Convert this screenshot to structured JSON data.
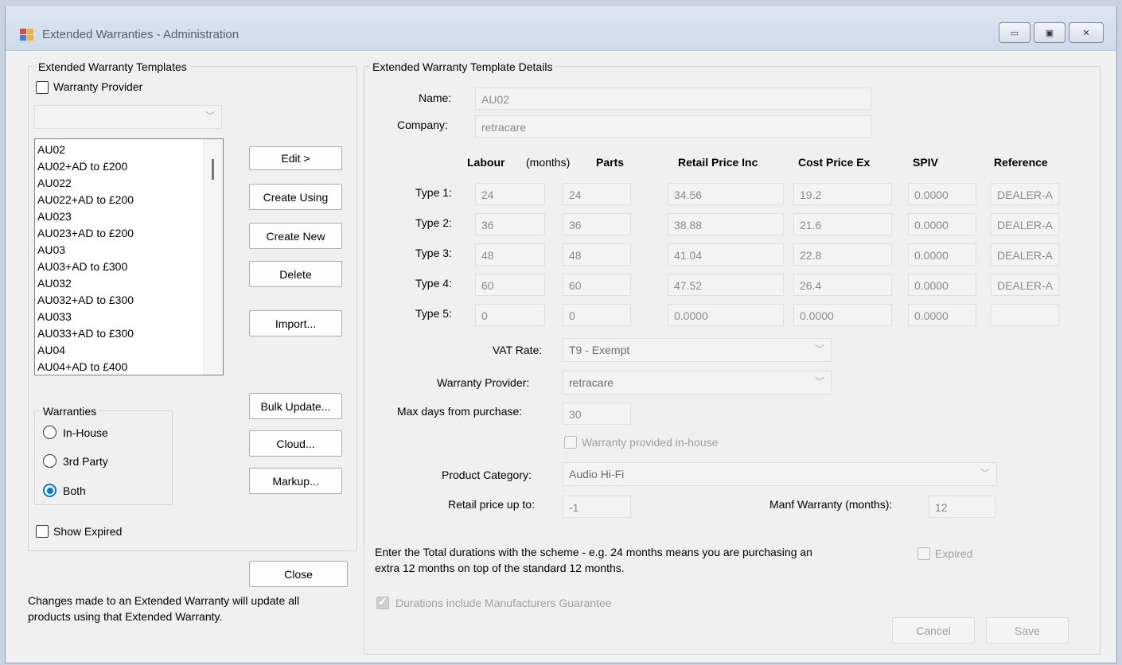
{
  "window": {
    "title": "Extended Warranties - Administration",
    "controls": {
      "minimize": "▭",
      "maximize": "▣",
      "close": "✕"
    }
  },
  "left": {
    "group_title": "Extended Warranty Templates",
    "provider_filter_label": "Warranty Provider",
    "provider_filter_checked": false,
    "provider_combo_value": "",
    "templates": [
      "AU02",
      "AU02+AD to £200",
      "AU022",
      "AU022+AD to £200",
      "AU023",
      "AU023+AD to £200",
      "AU03",
      "AU03+AD to £300",
      "AU032",
      "AU032+AD to £300",
      "AU033",
      "AU033+AD to £300",
      "AU04",
      "AU04+AD to £400"
    ],
    "buttons": {
      "edit": "Edit >",
      "create_using": "Create Using",
      "create_new": "Create New",
      "delete": "Delete",
      "import": "Import...",
      "bulk_update": "Bulk Update...",
      "cloud": "Cloud...",
      "markup": "Markup...",
      "close": "Close"
    },
    "warranties_group": {
      "title": "Warranties",
      "options": [
        "In-House",
        "3rd Party",
        "Both"
      ],
      "selected": "Both"
    },
    "show_expired_label": "Show Expired",
    "note": "Changes made to an Extended Warranty will update all products using that Extended Warranty."
  },
  "details": {
    "group_title": "Extended Warranty Template Details",
    "name_label": "Name:",
    "name_value": "AU02",
    "company_label": "Company:",
    "company_value": "retracare",
    "headers": {
      "labour": "Labour",
      "months": "(months)",
      "parts": "Parts",
      "retail": "Retail Price Inc",
      "cost": "Cost Price Ex",
      "spiv": "SPIV",
      "reference": "Reference"
    },
    "rows": [
      {
        "label": "Type 1:",
        "labour": "24",
        "parts": "24",
        "retail": "34.56",
        "cost": "19.2",
        "spiv": "0.0000",
        "reference": "DEALER-A"
      },
      {
        "label": "Type 2:",
        "labour": "36",
        "parts": "36",
        "retail": "38.88",
        "cost": "21.6",
        "spiv": "0.0000",
        "reference": "DEALER-A"
      },
      {
        "label": "Type 3:",
        "labour": "48",
        "parts": "48",
        "retail": "41.04",
        "cost": "22.8",
        "spiv": "0.0000",
        "reference": "DEALER-A"
      },
      {
        "label": "Type 4:",
        "labour": "60",
        "parts": "60",
        "retail": "47.52",
        "cost": "26.4",
        "spiv": "0.0000",
        "reference": "DEALER-A"
      },
      {
        "label": "Type 5:",
        "labour": "0",
        "parts": "0",
        "retail": "0.0000",
        "cost": "0.0000",
        "spiv": "0.0000",
        "reference": ""
      }
    ],
    "vat_label": "VAT Rate:",
    "vat_value": "T9 - Exempt",
    "provider_label": "Warranty Provider:",
    "provider_value": "retracare",
    "max_days_label": "Max days from purchase:",
    "max_days_value": "30",
    "inhouse_label": "Warranty provided in-house",
    "inhouse_checked": false,
    "category_label": "Product Category:",
    "category_value": "Audio Hi-Fi",
    "retail_upto_label": "Retail price up to:",
    "retail_upto_value": "-1",
    "manf_label": "Manf Warranty (months):",
    "manf_value": "12",
    "durations_note": "Enter the Total durations with the scheme - e.g. 24 months means you are purchasing an extra 12 months on top of the standard 12 months.",
    "expired_label": "Expired",
    "expired_checked": false,
    "include_guarantee_label": "Durations include Manufacturers Guarantee",
    "include_guarantee_checked": true,
    "cancel_label": "Cancel",
    "save_label": "Save"
  }
}
